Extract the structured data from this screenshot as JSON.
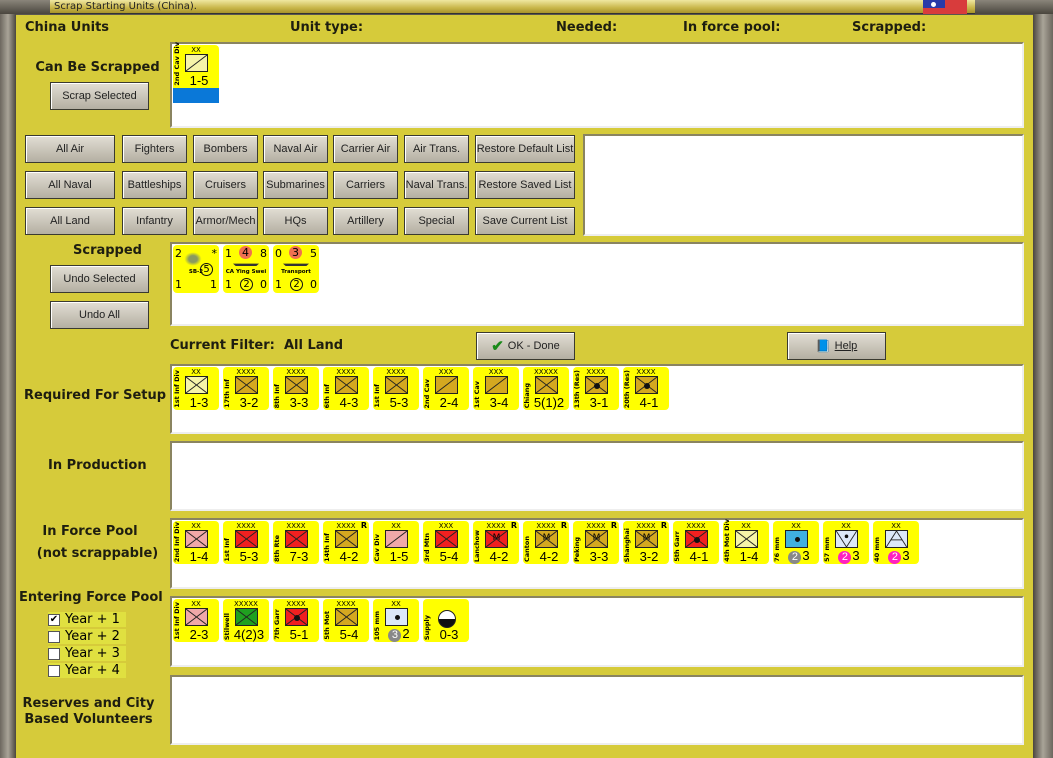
{
  "window": {
    "title": "Scrap Starting Units (China)."
  },
  "headers": {
    "country": "China Units",
    "unit_type": "Unit type:",
    "needed": "Needed:",
    "in_force_pool": "In force pool:",
    "scrapped": "Scrapped:"
  },
  "can_be_scrapped": {
    "label": "Can Be Scrapped",
    "button": "Scrap Selected",
    "units": [
      {
        "size": "XX",
        "name": "2nd Cav Div",
        "strength": "1-5",
        "color": "#f6f4a8",
        "symbol": "cav",
        "selected": true
      }
    ]
  },
  "filters": {
    "row1": [
      "All Air",
      "Fighters",
      "Bombers",
      "Naval Air",
      "Carrier Air",
      "Air Trans.",
      "Restore Default List"
    ],
    "row2": [
      "All Naval",
      "Battleships",
      "Cruisers",
      "Submarines",
      "Carriers",
      "Naval Trans.",
      "Restore Saved List"
    ],
    "row3": [
      "All Land",
      "Infantry",
      "Armor/Mech",
      "HQs",
      "Artillery",
      "Special",
      "Save Current List"
    ]
  },
  "scrapped": {
    "label": "Scrapped",
    "undo_selected": "Undo Selected",
    "undo_all": "Undo All",
    "units": [
      {
        "tl": "2",
        "tr": "*",
        "mid": "5",
        "name": "SB-2",
        "bl": "1",
        "bm": "",
        "br": "1"
      },
      {
        "tl": "1",
        "tm": "4",
        "tr": "8",
        "name": "CA Ying Swei",
        "bl": "1",
        "bm": "2",
        "br": "0"
      },
      {
        "tl": "0",
        "tm": "3",
        "tr": "5",
        "name": "Transport",
        "bl": "1",
        "bm": "2",
        "br": "0"
      }
    ]
  },
  "filter": {
    "label": "Current Filter:",
    "value": "All Land"
  },
  "ok_button": "OK - Done",
  "help_button": "Help",
  "sections": {
    "required": "Required For Setup",
    "production": "In Production",
    "force_pool_1": "In Force Pool",
    "force_pool_2": "(not scrappable)",
    "entering": "Entering Force Pool",
    "reserves_1": "Reserves and City",
    "reserves_2": "Based Volunteers"
  },
  "years": [
    {
      "label": "Year + 1",
      "checked": true
    },
    {
      "label": "Year + 2",
      "checked": false
    },
    {
      "label": "Year + 3",
      "checked": false
    },
    {
      "label": "Year + 4",
      "checked": false
    }
  ],
  "required_units": [
    {
      "size": "XX",
      "name": "1st Inf Div",
      "strength": "1-3",
      "color": "#f6f4a8",
      "symbol": "inf"
    },
    {
      "size": "XXXX",
      "name": "17th Inf",
      "strength": "3-2",
      "color": "#d4a820",
      "symbol": "inf"
    },
    {
      "size": "XXXX",
      "name": "8th Inf",
      "strength": "3-3",
      "color": "#d4a820",
      "symbol": "inf"
    },
    {
      "size": "XXXX",
      "name": "6th Inf",
      "strength": "4-3",
      "color": "#d4a820",
      "symbol": "inf"
    },
    {
      "size": "XXXX",
      "name": "1st Inf",
      "strength": "5-3",
      "color": "#d4a820",
      "symbol": "inf"
    },
    {
      "size": "XXX",
      "name": "2nd Cav",
      "strength": "2-4",
      "color": "#d4a820",
      "symbol": "cav"
    },
    {
      "size": "XXX",
      "name": "1st Cav",
      "strength": "3-4",
      "color": "#d4a820",
      "symbol": "cav"
    },
    {
      "size": "XXXXX",
      "name": "Chiang",
      "strength": "5(1)2",
      "color": "#d4a820",
      "symbol": "inf"
    },
    {
      "size": "XXXX",
      "name": "13th (Res)",
      "strength": "3-1",
      "color": "#d4a820",
      "symbol": "gar"
    },
    {
      "size": "XXXX",
      "name": "20th (Res)",
      "strength": "4-1",
      "color": "#d4a820",
      "symbol": "gar"
    }
  ],
  "force_pool_units": [
    {
      "size": "XX",
      "name": "2nd Inf Div",
      "strength": "1-4",
      "color": "#f0a8a8",
      "symbol": "inf"
    },
    {
      "size": "XXXX",
      "name": "1st Inf",
      "strength": "5-3",
      "color": "#f02020",
      "symbol": "inf"
    },
    {
      "size": "XXXX",
      "name": "8th Rte",
      "strength": "7-3",
      "color": "#f02020",
      "symbol": "inf"
    },
    {
      "size": "XXXX",
      "name": "14th Inf",
      "strength": "4-2",
      "color": "#d4a820",
      "symbol": "inf",
      "r": "R"
    },
    {
      "size": "XX",
      "name": "Cav Div",
      "strength": "1-5",
      "color": "#f0a8a8",
      "symbol": "cav"
    },
    {
      "size": "XXX",
      "name": "3rd Mtn",
      "strength": "5-4",
      "color": "#f02020",
      "symbol": "inf"
    },
    {
      "size": "XXXX",
      "name": "Lanchow",
      "strength": "4-2",
      "color": "#f02020",
      "symbol": "m",
      "r": "R"
    },
    {
      "size": "XXXX",
      "name": "Canton",
      "strength": "4-2",
      "color": "#d4a820",
      "symbol": "m",
      "r": "R"
    },
    {
      "size": "XXXX",
      "name": "Peking",
      "strength": "3-3",
      "color": "#d4a820",
      "symbol": "m",
      "r": "R"
    },
    {
      "size": "XXXX",
      "name": "Shanghai",
      "strength": "3-2",
      "color": "#d4a820",
      "symbol": "m",
      "r": "R"
    },
    {
      "size": "XXXX",
      "name": "5th Garr",
      "strength": "4-1",
      "color": "#f02020",
      "symbol": "gar"
    },
    {
      "size": "XX",
      "name": "4th Mot Div",
      "strength": "1-4",
      "color": "#f6f4a8",
      "symbol": "inf"
    },
    {
      "size": "XX",
      "name": "76 mm",
      "strength": "3",
      "badge": "2",
      "badge_color": "#888888",
      "color": "#40b0e0",
      "symbol": "dot"
    },
    {
      "size": "XX",
      "name": "57 mm",
      "strength": "3",
      "badge": "2",
      "badge_color": "#ff20c0",
      "color": "#dce8f8",
      "symbol": "at"
    },
    {
      "size": "XX",
      "name": "40 mm",
      "strength": "3",
      "badge": "2",
      "badge_color": "#ff20c0",
      "color": "#dce8f8",
      "symbol": "aa"
    }
  ],
  "entering_units": [
    {
      "size": "XX",
      "name": "1st Inf Div",
      "strength": "2-3",
      "color": "#f0a8a8",
      "symbol": "inf"
    },
    {
      "size": "XXXXX",
      "name": "Stilwell",
      "strength": "4(2)3",
      "color": "#20a020",
      "symbol": "inf"
    },
    {
      "size": "XXXX",
      "name": "7th Garr",
      "strength": "5-1",
      "color": "#f02020",
      "symbol": "gar"
    },
    {
      "size": "XXXX",
      "name": "5th Mot",
      "strength": "5-4",
      "color": "#d4a820",
      "symbol": "inf"
    },
    {
      "size": "XX",
      "name": "105 mm",
      "strength": "2",
      "badge": "3",
      "badge_color": "#888888",
      "color": "#dce8f8",
      "symbol": "dot"
    },
    {
      "size": "",
      "name": "Supply",
      "strength": "0-3",
      "color": "#ffff00",
      "symbol": "supply"
    }
  ]
}
